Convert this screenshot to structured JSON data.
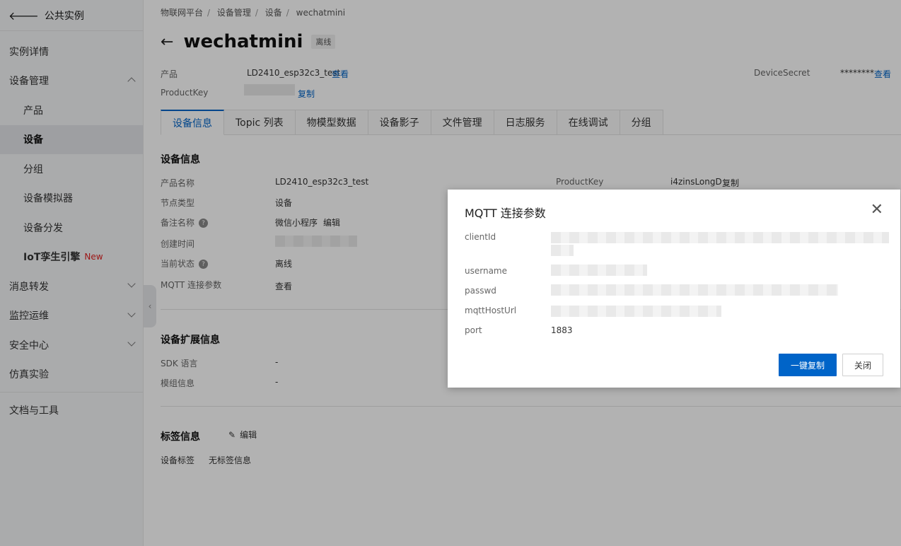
{
  "sidebar": {
    "back_label": "公共实例",
    "items": [
      {
        "label": "实例详情"
      },
      {
        "label": "设备管理"
      },
      {
        "label": "产品"
      },
      {
        "label": "设备"
      },
      {
        "label": "分组"
      },
      {
        "label": "设备模拟器"
      },
      {
        "label": "设备分发"
      },
      {
        "label": "IoT孪生引擎",
        "badge": "New"
      },
      {
        "label": "消息转发"
      },
      {
        "label": "监控运维"
      },
      {
        "label": "安全中心"
      },
      {
        "label": "仿真实验"
      },
      {
        "label": "文档与工具"
      }
    ]
  },
  "breadcrumb": [
    "物联网平台",
    "设备管理",
    "设备",
    "wechatmini"
  ],
  "header": {
    "title": "wechatmini",
    "status": "离线",
    "product_label": "产品",
    "product_value": "LD2410_esp32c3_test",
    "view_label": "查看",
    "productkey_label": "ProductKey",
    "copy_label": "复制",
    "devicesecret_label": "DeviceSecret",
    "devicesecret_value": "********",
    "devicesecret_view": "查看"
  },
  "tabs": [
    "设备信息",
    "Topic 列表",
    "物模型数据",
    "设备影子",
    "文件管理",
    "日志服务",
    "在线调试",
    "分组"
  ],
  "device_info": {
    "title": "设备信息",
    "rows": [
      {
        "label": "产品名称",
        "value": "LD2410_esp32c3_test"
      },
      {
        "label": "节点类型",
        "value": "设备"
      },
      {
        "label": "备注名称",
        "value": "微信小程序",
        "action": "编辑"
      },
      {
        "label": "创建时间",
        "value": ""
      },
      {
        "label": "当前状态",
        "value": "离线"
      },
      {
        "label": "MQTT 连接参数",
        "value": "查看"
      }
    ],
    "productkey_label": "ProductKey",
    "productkey_value": "i4zinsLongD",
    "productkey_copy": "复制"
  },
  "ext_info": {
    "title": "设备扩展信息",
    "rows": [
      {
        "label": "SDK 语言",
        "value": "-"
      },
      {
        "label": "模组信息",
        "value": "-"
      }
    ]
  },
  "tag_info": {
    "title": "标签信息",
    "edit_label": "编辑",
    "row_label": "设备标签",
    "row_value": "无标签信息"
  },
  "dialog": {
    "title": "MQTT 连接参数",
    "fields": [
      {
        "label": "clientId",
        "value": ""
      },
      {
        "label": "username",
        "value": ""
      },
      {
        "label": "passwd",
        "value": ""
      },
      {
        "label": "mqttHostUrl",
        "value": ""
      },
      {
        "label": "port",
        "value": "1883"
      }
    ],
    "copy_all_label": "一键复制",
    "close_label": "关闭"
  }
}
